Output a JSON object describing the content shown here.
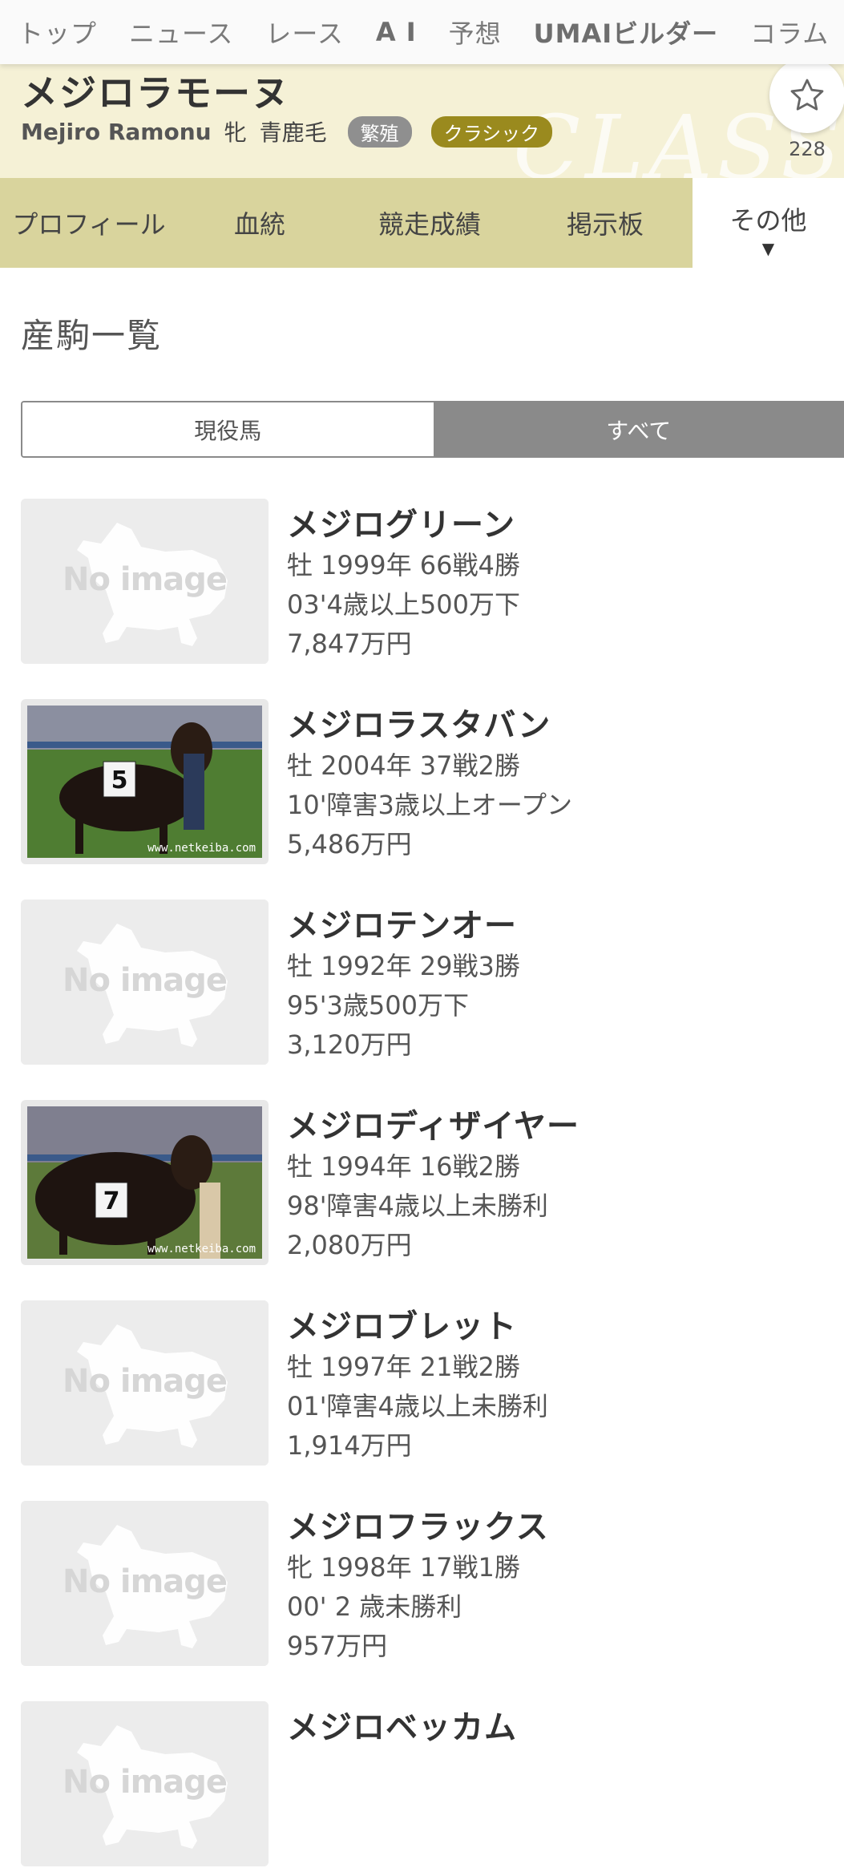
{
  "nav": {
    "items": [
      "トップ",
      "ニュース",
      "レース",
      "A I",
      "予想",
      "UMAIビルダー",
      "コラム"
    ]
  },
  "horse": {
    "name": "メジロラモーヌ",
    "name_en": "Mejiro Ramonu",
    "sex": "牝",
    "coat": "青鹿毛",
    "badges": [
      {
        "label": "繁殖",
        "color": "#8f8f8f"
      },
      {
        "label": "クラシック",
        "color": "#9a8a1e"
      }
    ],
    "watermark": "CLASSIC",
    "fav_count": "228"
  },
  "tabs": [
    {
      "label": "プロフィール",
      "active": false
    },
    {
      "label": "血統",
      "active": false
    },
    {
      "label": "競走成績",
      "active": false
    },
    {
      "label": "掲示板",
      "active": false
    },
    {
      "label": "その他",
      "active": true,
      "caret": "▼"
    }
  ],
  "section": {
    "title": "産駒一覧",
    "filter": [
      {
        "label": "現役馬",
        "selected": false
      },
      {
        "label": "すべて",
        "selected": true
      }
    ]
  },
  "no_image_text": "No image",
  "photo_caption": "www.netkeiba.com",
  "offspring": [
    {
      "name": "メジログリーン",
      "info": "牡 1999年 66戦4勝",
      "last_race": "03'4歳以上500万下",
      "earnings": "7,847万円",
      "image": "none"
    },
    {
      "name": "メジロラスタバン",
      "info": "牡 2004年 37戦2勝",
      "last_race": "10'障害3歳以上オープン",
      "earnings": "5,486万円",
      "image": "photo",
      "bib": "5"
    },
    {
      "name": "メジロテンオー",
      "info": "牡 1992年 29戦3勝",
      "last_race": "95'3歳500万下",
      "earnings": "3,120万円",
      "image": "none"
    },
    {
      "name": "メジロディザイヤー",
      "info": "牡 1994年 16戦2勝",
      "last_race": "98'障害4歳以上未勝利",
      "earnings": "2,080万円",
      "image": "photo",
      "bib": "7"
    },
    {
      "name": "メジロブレット",
      "info": "牡 1997年 21戦2勝",
      "last_race": "01'障害4歳以上未勝利",
      "earnings": "1,914万円",
      "image": "none"
    },
    {
      "name": "メジロフラックス",
      "info": "牝 1998年 17戦1勝",
      "last_race": "00' 2 歳未勝利",
      "earnings": "957万円",
      "image": "none"
    },
    {
      "name": "メジロベッカム",
      "info": "",
      "last_race": "",
      "earnings": "",
      "image": "none"
    }
  ]
}
